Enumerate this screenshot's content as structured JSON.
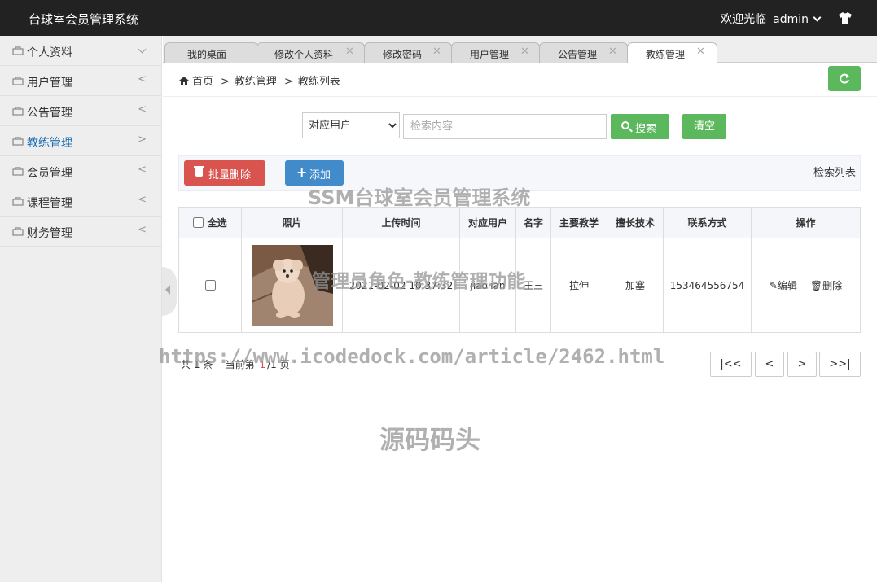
{
  "header": {
    "app_title": "台球室会员管理系统",
    "welcome": "欢迎光临",
    "user": "admin"
  },
  "sidebar": {
    "items": [
      {
        "label": "个人资料",
        "arrow": "down"
      },
      {
        "label": "用户管理",
        "arrow": "<"
      },
      {
        "label": "公告管理",
        "arrow": "<"
      },
      {
        "label": "教练管理",
        "arrow": ">",
        "active": true
      },
      {
        "label": "会员管理",
        "arrow": "<"
      },
      {
        "label": "课程管理",
        "arrow": "<"
      },
      {
        "label": "财务管理",
        "arrow": "<"
      }
    ]
  },
  "tabs": [
    {
      "label": "我的桌面",
      "closable": false
    },
    {
      "label": "修改个人资料",
      "closable": true
    },
    {
      "label": "修改密码",
      "closable": true
    },
    {
      "label": "用户管理",
      "closable": true
    },
    {
      "label": "公告管理",
      "closable": true
    },
    {
      "label": "教练管理",
      "closable": true,
      "active": true
    }
  ],
  "breadcrumb": {
    "home": "首页",
    "level1": "教练管理",
    "level2": "教练列表",
    "sep": ">"
  },
  "search": {
    "select_value": "对应用户",
    "placeholder": "检索内容",
    "search_label": "搜索",
    "clear_label": "清空"
  },
  "actions": {
    "batch_delete": "批量删除",
    "add": "添加",
    "list_label": "检索列表"
  },
  "table": {
    "headers": [
      "全选",
      "照片",
      "上传时间",
      "对应用户",
      "名字",
      "主要教学",
      "擅长技术",
      "联系方式",
      "操作"
    ],
    "rows": [
      {
        "upload_time": "2021-02-02 10:37:32",
        "user": "jiaolian",
        "name": "王三",
        "teaching": "拉伸",
        "skill": "加塞",
        "contact": "153464556754"
      }
    ],
    "edit_label": "编辑",
    "delete_label": "删除"
  },
  "pagination": {
    "total_prefix": "共",
    "total": "1",
    "total_suffix": "条",
    "current_prefix": "当前第",
    "current": "1",
    "pages": "/1",
    "pages_suffix": "页",
    "first": "|<<",
    "prev": "<",
    "next": ">",
    "last": ">>|"
  },
  "watermarks": {
    "line1": "SSM台球室会员管理系统",
    "line2": "管理员角色-教练管理功能",
    "line3": "https://www.icodedock.com/article/2462.html",
    "line4": "源码码头"
  },
  "colors": {
    "header_bg": "#222222",
    "accent_green": "#5cb85c",
    "danger_red": "#d9534f",
    "primary_blue": "#428bca",
    "active_sidebar": "#1e6fb3"
  }
}
